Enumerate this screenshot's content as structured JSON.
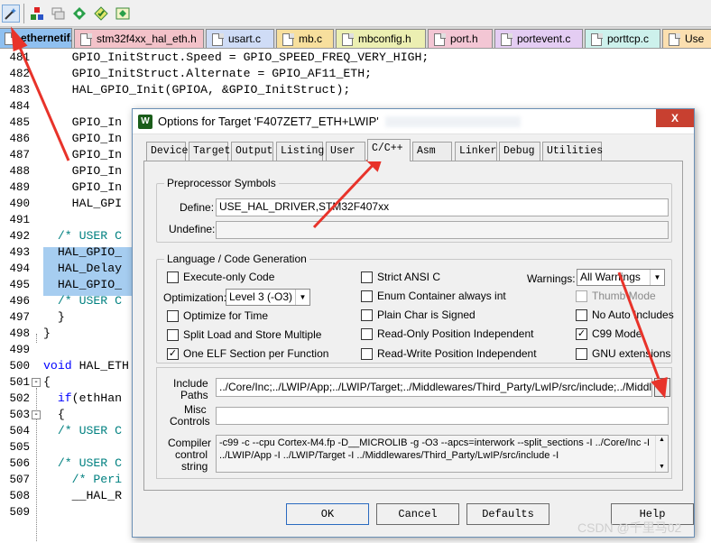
{
  "toolbar": {
    "icons": [
      "wand-icon",
      "build-target-icon",
      "batch-build-icon",
      "manage-components-icon",
      "select-software-packs-icon",
      "pack-installer-icon"
    ]
  },
  "file_tabs": [
    {
      "label": "ethernetif.c",
      "color": "#8fc0f0"
    },
    {
      "label": "stm32f4xx_hal_eth.h",
      "color": "#f3c2c9"
    },
    {
      "label": "usart.c",
      "color": "#cfdcf6"
    },
    {
      "label": "mb.c",
      "color": "#f7df9d"
    },
    {
      "label": "mbconfig.h",
      "color": "#ecefb2"
    },
    {
      "label": "port.h",
      "color": "#f3c6d4"
    },
    {
      "label": "portevent.c",
      "color": "#e4cdf3"
    },
    {
      "label": "porttcp.c",
      "color": "#cdf1ec"
    },
    {
      "label": "Use",
      "color": "#fbdfb0"
    }
  ],
  "code": {
    "line_numbers": [
      "481",
      "482",
      "483",
      "484",
      "485",
      "486",
      "487",
      "488",
      "489",
      "490",
      "491",
      "492",
      "493",
      "494",
      "495",
      "496",
      "497",
      "498",
      "499",
      "500",
      "501",
      "502",
      "503",
      "504",
      "505",
      "506",
      "507",
      "508",
      "509"
    ],
    "lines": [
      "    GPIO_InitStruct.Speed = GPIO_SPEED_FREQ_VERY_HIGH;",
      "    GPIO_InitStruct.Alternate = GPIO_AF11_ETH;",
      "    HAL_GPIO_Init(GPIOA, &GPIO_InitStruct);",
      "",
      "    GPIO_In",
      "    GPIO_In",
      "    GPIO_In",
      "    GPIO_In",
      "    GPIO_In",
      "    HAL_GPI",
      "",
      "  /* USER C",
      "  HAL_GPIO_",
      "  HAL_Delay",
      "  HAL_GPIO_",
      "  /* USER C",
      "  }",
      "}",
      "",
      "void HAL_ETH",
      "{",
      "  if(ethHan",
      "  {",
      "  /* USER C",
      "",
      "  /* USER C",
      "    /* Peri",
      "    __HAL_R",
      ""
    ]
  },
  "dialog": {
    "title": "Options for Target 'F407ZET7_ETH+LWIP'",
    "close_label": "X",
    "tabs": [
      "Device",
      "Target",
      "Output",
      "Listing",
      "User",
      "C/C++",
      "Asm",
      "Linker",
      "Debug",
      "Utilities"
    ],
    "active_tab": "C/C++",
    "preprocessor": {
      "group_title": "Preprocessor Symbols",
      "define_label": "Define:",
      "define_value": "USE_HAL_DRIVER,STM32F407xx",
      "undefine_label": "Undefine:",
      "undefine_value": ""
    },
    "language": {
      "group_title": "Language / Code Generation",
      "execute_only_label": "Execute-only Code",
      "optimization_label": "Optimization:",
      "optimization_value": "Level 3 (-O3)",
      "optimize_time_label": "Optimize for Time",
      "split_load_label": "Split Load and Store Multiple",
      "one_elf_label": "One ELF Section per Function",
      "strict_ansi_label": "Strict ANSI C",
      "enum_container_label": "Enum Container always int",
      "plain_char_label": "Plain Char is Signed",
      "readonly_pos_label": "Read-Only Position Independent",
      "readwrite_pos_label": "Read-Write Position Independent",
      "warnings_label": "Warnings:",
      "warnings_value": "All Warnings",
      "thumb_mode_label": "Thumb Mode",
      "no_auto_includes_label": "No Auto Includes",
      "c99_label": "C99 Mode",
      "gnu_ext_label": "GNU extensions",
      "checked_mark": "✓"
    },
    "include_paths_label_1": "Include",
    "include_paths_label_2": "Paths",
    "include_paths_value": "../Core/Inc;../LWIP/App;../LWIP/Target;../Middlewares/Third_Party/LwIP/src/include;../Middlewares",
    "browse_label": "...",
    "misc_controls_label_1": "Misc",
    "misc_controls_label_2": "Controls",
    "misc_controls_value": "",
    "compiler_string_label_1": "Compiler",
    "compiler_string_label_2": "control",
    "compiler_string_label_3": "string",
    "compiler_string_line1": "-c99 -c --cpu Cortex-M4.fp -D__MICROLIB -g -O3 --apcs=interwork --split_sections -I ../Core/Inc -I",
    "compiler_string_line2": "../LWIP/App -I ../LWIP/Target -I ../Middlewares/Third_Party/LwIP/src/include -I",
    "buttons": {
      "ok": "OK",
      "cancel": "Cancel",
      "defaults": "Defaults",
      "help": "Help"
    }
  },
  "watermark": "CSDN @千里马02",
  "colors": {
    "arrow": "#e8332a",
    "selection": "#a6cdf0",
    "comment": "#008080",
    "keyword": "#0000ff"
  }
}
